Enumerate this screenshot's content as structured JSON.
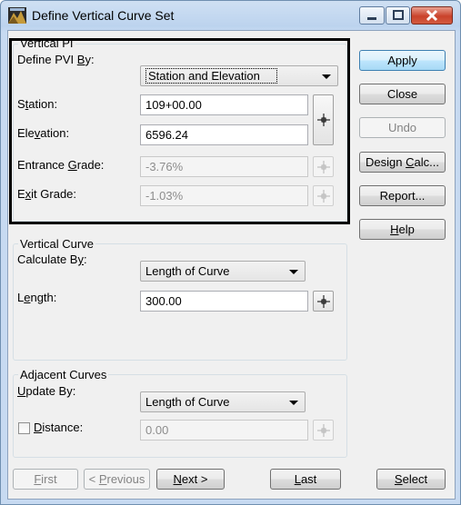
{
  "window": {
    "title": "Define Vertical Curve Set"
  },
  "vertical_pi": {
    "group_label": "Vertical PI",
    "define_pvi_by_prefix": "Define PVI ",
    "define_pvi_by_accel": "B",
    "define_pvi_by_suffix": "y:",
    "define_pvi_by_value": "Station and Elevation",
    "station_prefix": "S",
    "station_accel": "t",
    "station_suffix": "ation:",
    "station_value": "109+00.00",
    "elevation_prefix": "Ele",
    "elevation_accel": "v",
    "elevation_suffix": "ation:",
    "elevation_value": "6596.24",
    "entrance_grade_prefix": "Entrance ",
    "entrance_grade_accel": "G",
    "entrance_grade_suffix": "rade:",
    "entrance_grade_value": "-3.76%",
    "exit_grade_prefix": "E",
    "exit_grade_accel": "x",
    "exit_grade_suffix": "it Grade:",
    "exit_grade_value": "-1.03%"
  },
  "vertical_curve": {
    "group_label": "Vertical Curve",
    "calculate_by_prefix": "Calculate B",
    "calculate_by_accel": "y",
    "calculate_by_suffix": ":",
    "calculate_by_value": "Length of Curve",
    "length_prefix": "L",
    "length_accel": "e",
    "length_suffix": "ngth:",
    "length_value": "300.00"
  },
  "adjacent_curves": {
    "group_label": "Adjacent Curves",
    "update_by_accel": "U",
    "update_by_suffix": "pdate By:",
    "update_by_value": "Length of Curve",
    "distance_accel": "D",
    "distance_suffix": "istance:",
    "distance_checked": false,
    "distance_value": "0.00"
  },
  "side_buttons": {
    "apply": "Apply",
    "close": "Close",
    "undo": "Undo",
    "design_calc_prefix": "Design ",
    "design_calc_accel": "C",
    "design_calc_suffix": "alc...",
    "report": "Report...",
    "help_accel": "H",
    "help_suffix": "elp"
  },
  "bottom_buttons": {
    "first_accel": "F",
    "first_suffix": "irst",
    "previous_prefix": "< ",
    "previous_accel": "P",
    "previous_suffix": "revious",
    "next_accel": "N",
    "next_suffix": "ext >",
    "last_accel": "L",
    "last_suffix": "ast",
    "select_accel": "S",
    "select_suffix": "elect"
  }
}
